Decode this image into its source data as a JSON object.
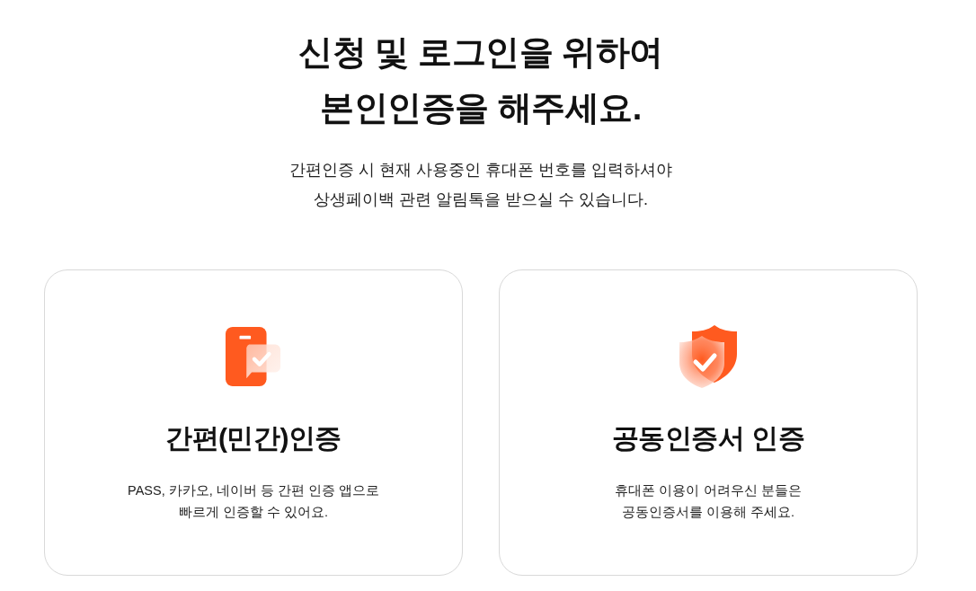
{
  "heading": "신청 및 로그인을 위하여\n본인인증을 해주세요.",
  "intro": "간편인증 시 현재 사용중인 휴대폰 번호를 입력하셔야\n상생페이백 관련 알림톡을 받으실 수 있습니다.",
  "options": [
    {
      "kind": "phone",
      "title": "간편(민간)인증",
      "description": "PASS, 카카오, 네이버 등 간편 인증 앱으로\n빠르게 인증할 수 있어요."
    },
    {
      "kind": "shield",
      "title": "공동인증서 인증",
      "description": "휴대폰 이용이 어려우신 분들은\n공동인증서를 이용해 주세요."
    }
  ]
}
